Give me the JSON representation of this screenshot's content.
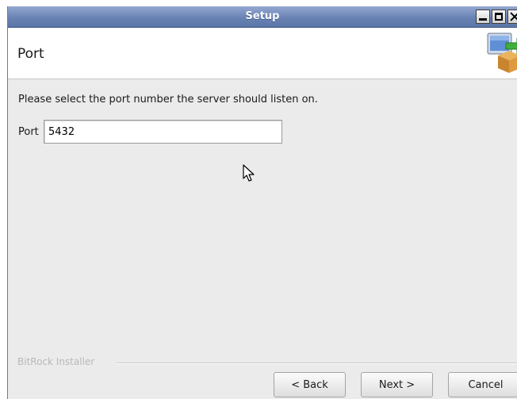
{
  "window": {
    "title": "Setup"
  },
  "header": {
    "title": "Port",
    "logo_icon": "installer-box-icon"
  },
  "content": {
    "instruction": "Please select the port number the server should listen on.",
    "port_label": "Port",
    "port_value": "5432"
  },
  "footer": {
    "branding": "BitRock Installer",
    "back_label": "< Back",
    "next_label": "Next >",
    "cancel_label": "Cancel"
  },
  "colors": {
    "titlebar": "#6a83b5",
    "window_bg": "#ebebeb",
    "header_bg": "#ffffff"
  }
}
